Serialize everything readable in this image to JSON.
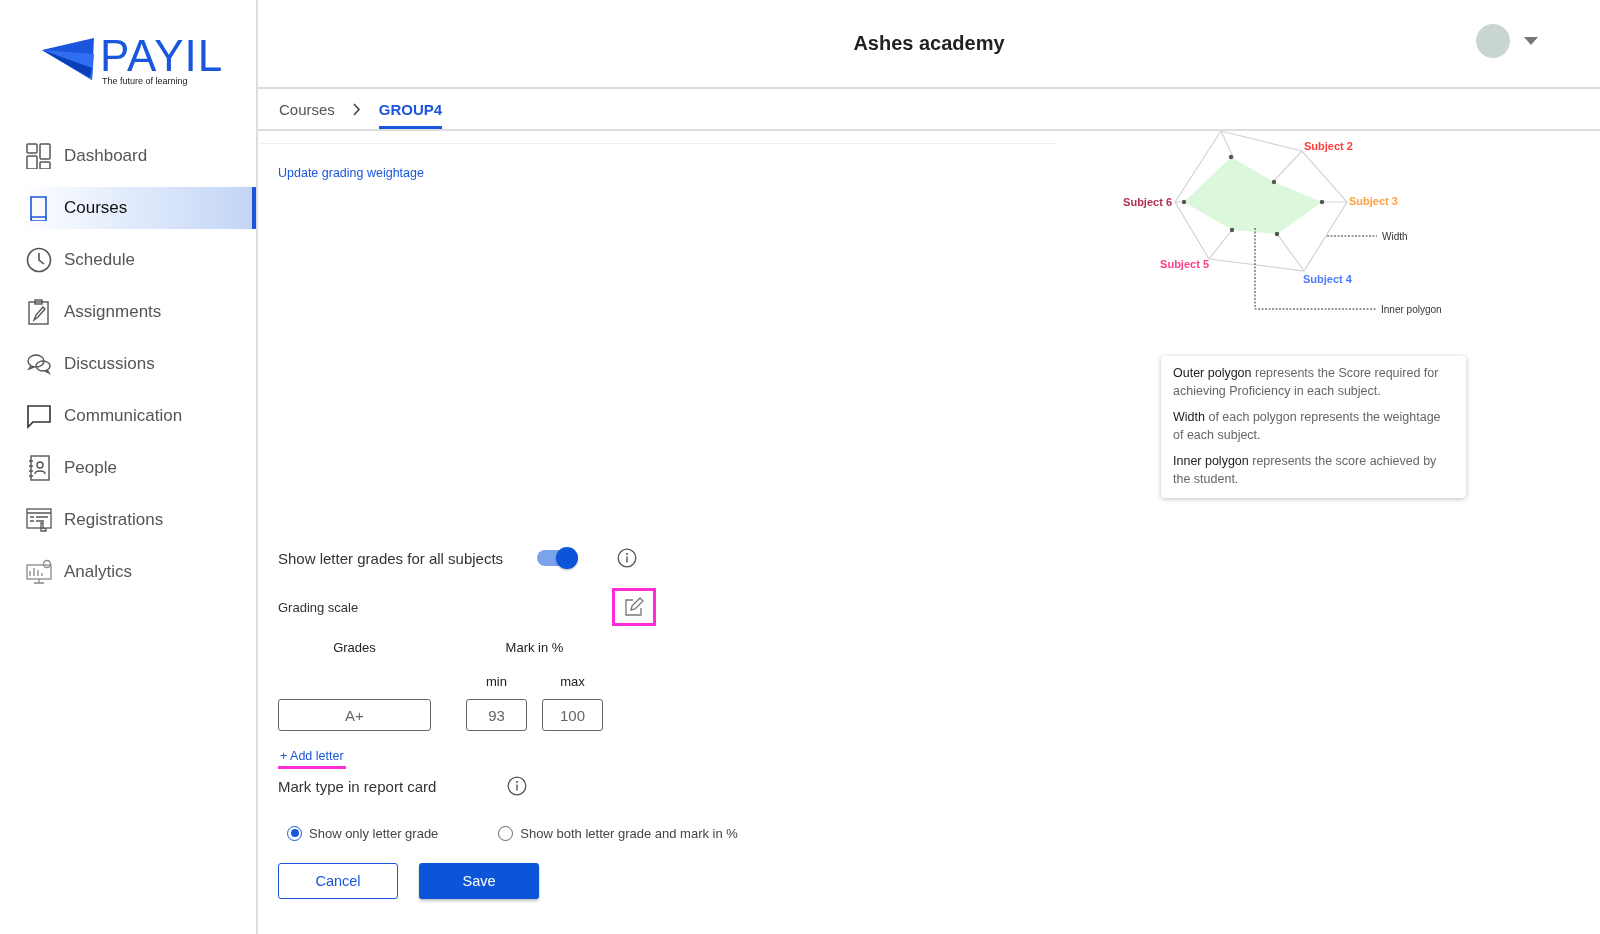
{
  "logo": {
    "name": "PAYIL",
    "tagline": "The future of learning"
  },
  "sidebar": {
    "items": [
      {
        "label": "Dashboard",
        "selected": false
      },
      {
        "label": "Courses",
        "selected": true
      },
      {
        "label": "Schedule",
        "selected": false
      },
      {
        "label": "Assignments",
        "selected": false
      },
      {
        "label": "Discussions",
        "selected": false
      },
      {
        "label": "Communication",
        "selected": false
      },
      {
        "label": "People",
        "selected": false
      },
      {
        "label": "Registrations",
        "selected": false
      },
      {
        "label": "Analytics",
        "selected": false
      }
    ]
  },
  "header": {
    "title": "Ashes academy"
  },
  "breadcrumbs": [
    {
      "label": "Courses",
      "selected": false
    },
    {
      "label": "GROUP4",
      "selected": true
    }
  ],
  "update_link": "Update grading weightage",
  "diagram": {
    "subjects": [
      {
        "label": "Subject 2",
        "color": "#ff3b3b"
      },
      {
        "label": "Subject 3",
        "color": "#ffa040"
      },
      {
        "label": "Subject 4",
        "color": "#4a7bff"
      },
      {
        "label": "Subject 5",
        "color": "#ff3d8a"
      },
      {
        "label": "Subject 6",
        "color": "#b03050"
      }
    ],
    "annotations": [
      "Width",
      "Inner polygon"
    ],
    "notes": [
      "**Outer polygon** represents the Score required for achieving Proficiency in each subject.",
      "**Width** of each polygon represents the weightage of each subject.",
      "**Inner polygon** represents the score achieved by the student."
    ]
  },
  "form": {
    "letter_grades": {
      "label": "Show letter grades for all subjects",
      "on": true
    },
    "grading_scale": {
      "label": "Grading scale",
      "edit_highlighted": true
    },
    "columns": {
      "grades": "Grades",
      "mark": "Mark in %",
      "min": "min",
      "max": "max"
    },
    "rows": [
      {
        "grade": "A+",
        "min": "93",
        "max": "100"
      }
    ],
    "add_letter": {
      "label": "+ Add letter",
      "highlighted": true
    },
    "mark_type": {
      "label": "Mark type in report card",
      "options": [
        {
          "label": "Show only letter grade",
          "selected": true
        },
        {
          "label": "Show both letter grade and mark in %",
          "selected": false
        }
      ]
    },
    "buttons": {
      "cancel": "Cancel",
      "save": "Save"
    }
  }
}
